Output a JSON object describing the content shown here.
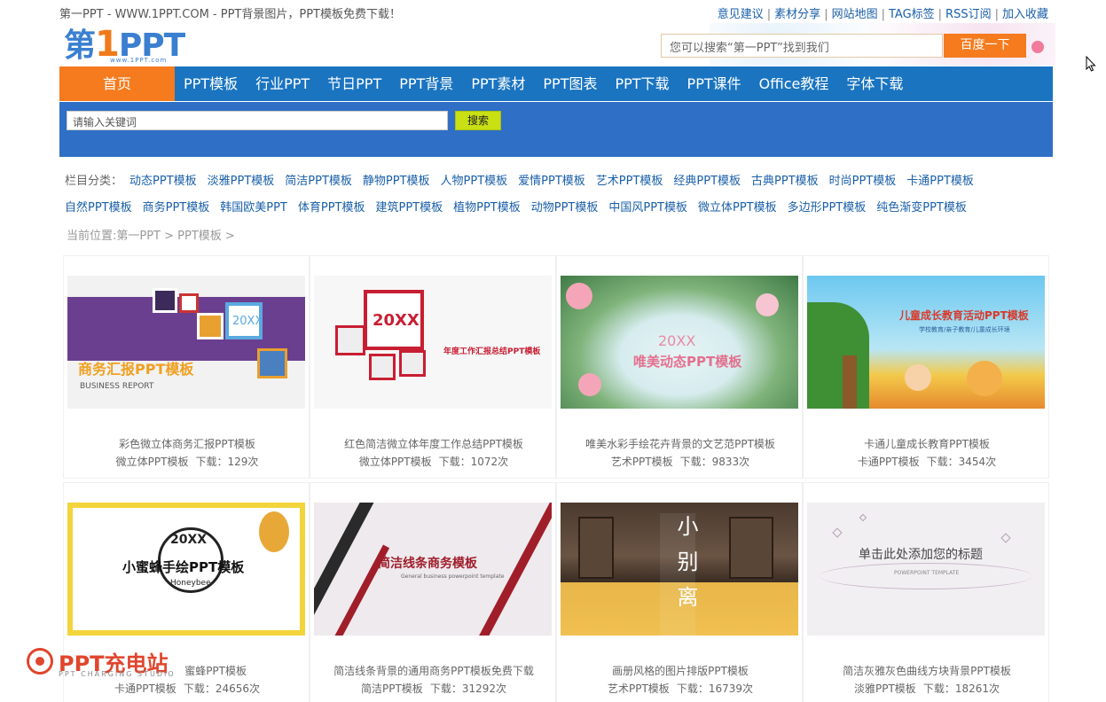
{
  "top": {
    "site_title": "第一PPT - WWW.1PPT.COM - PPT背景图片，PPT模板免费下载！",
    "links": [
      "意见建议",
      "素材分享",
      "网站地图",
      "TAG标签",
      "RSS订阅",
      "加入收藏"
    ],
    "link_separator": "|"
  },
  "header": {
    "logo_text_a": "第",
    "logo_text_b": "1",
    "logo_text_c": "PPT",
    "logo_sub": "www.1PPT.com",
    "search_placeholder": "您可以搜索“第一PPT”找到我们",
    "search_button": "百度一下"
  },
  "nav": {
    "home": "首页",
    "items": [
      "PPT模板",
      "行业PPT",
      "节日PPT",
      "PPT背景",
      "PPT素材",
      "PPT图表",
      "PPT下载",
      "PPT课件",
      "Office教程",
      "字体下载"
    ]
  },
  "keyword_search": {
    "placeholder": "请输入关键词",
    "button": "搜索"
  },
  "categories": {
    "label": "栏目分类：",
    "items": [
      "动态PPT模板",
      "淡雅PPT模板",
      "简洁PPT模板",
      "静物PPT模板",
      "人物PPT模板",
      "爱情PPT模板",
      "艺术PPT模板",
      "经典PPT模板",
      "古典PPT模板",
      "时尚PPT模板",
      "卡通PPT模板",
      "自然PPT模板",
      "商务PPT模板",
      "韩国欧美PPT",
      "体育PPT模板",
      "建筑PPT模板",
      "植物PPT模板",
      "动物PPT模板",
      "中国风PPT模板",
      "微立体PPT模板",
      "多边形PPT模板",
      "纯色渐变PPT模板"
    ]
  },
  "breadcrumb": "当前位置:第一PPT > PPT模板 >",
  "cards": [
    {
      "title": "彩色微立体商务汇报PPT模板",
      "category": "微立体PPT模板",
      "downloads": "下载：129次",
      "thumb_title": "商务汇报PPT模板",
      "thumb_sub": "BUSINESS REPORT",
      "thumb_badge": "20XX"
    },
    {
      "title": "红色简洁微立体年度工作总结PPT模板",
      "category": "微立体PPT模板",
      "downloads": "下载：1072次",
      "thumb_title": "年度工作汇报总结PPT模板",
      "thumb_badge": "20XX"
    },
    {
      "title": "唯美水彩手绘花卉背景的文艺范PPT模板",
      "category": "艺术PPT模板",
      "downloads": "下载：9833次",
      "thumb_title": "唯美动态PPT模板",
      "thumb_badge": "20XX"
    },
    {
      "title": "卡通儿童成长教育PPT模板",
      "category": "卡通PPT模板",
      "downloads": "下载：3454次",
      "thumb_title": "儿童成长教育活动PPT模板",
      "thumb_sub": "学校教育/亲子教育/儿童成长环境"
    },
    {
      "title": "小蜜蜂手绘PPT模板",
      "title_visible": "蜜蜂PPT模板",
      "category": "卡通PPT模板",
      "downloads": "下载：24656次",
      "thumb_title": "小蜜蜂手绘PPT模板",
      "thumb_badge": "20XX",
      "thumb_sub": "Honeybee"
    },
    {
      "title": "简洁线条背景的通用商务PPT模板免费下载",
      "category": "简洁PPT模板",
      "downloads": "下载：31292次",
      "thumb_title": "简洁线条商务模板",
      "thumb_sub": "General business powerpoint template"
    },
    {
      "title": "画册风格的图片排版PPT模板",
      "category": "艺术PPT模板",
      "downloads": "下载：16739次",
      "thumb_title": "小别离"
    },
    {
      "title": "简洁灰雅灰色曲线方块背景PPT模板",
      "category": "淡雅PPT模板",
      "downloads": "下载：18261次",
      "thumb_title": "单击此处添加您的标题",
      "thumb_sub": "POWERPOINT TEMPLATE"
    }
  ],
  "watermark": {
    "text": "PPT充电站",
    "sub": "PPT CHARGING STUDIO"
  },
  "colors": {
    "nav_blue": "#1a74c0",
    "band_blue": "#2f6fc5",
    "accent_orange": "#f57b1e",
    "link_blue": "#1a5fa8"
  }
}
